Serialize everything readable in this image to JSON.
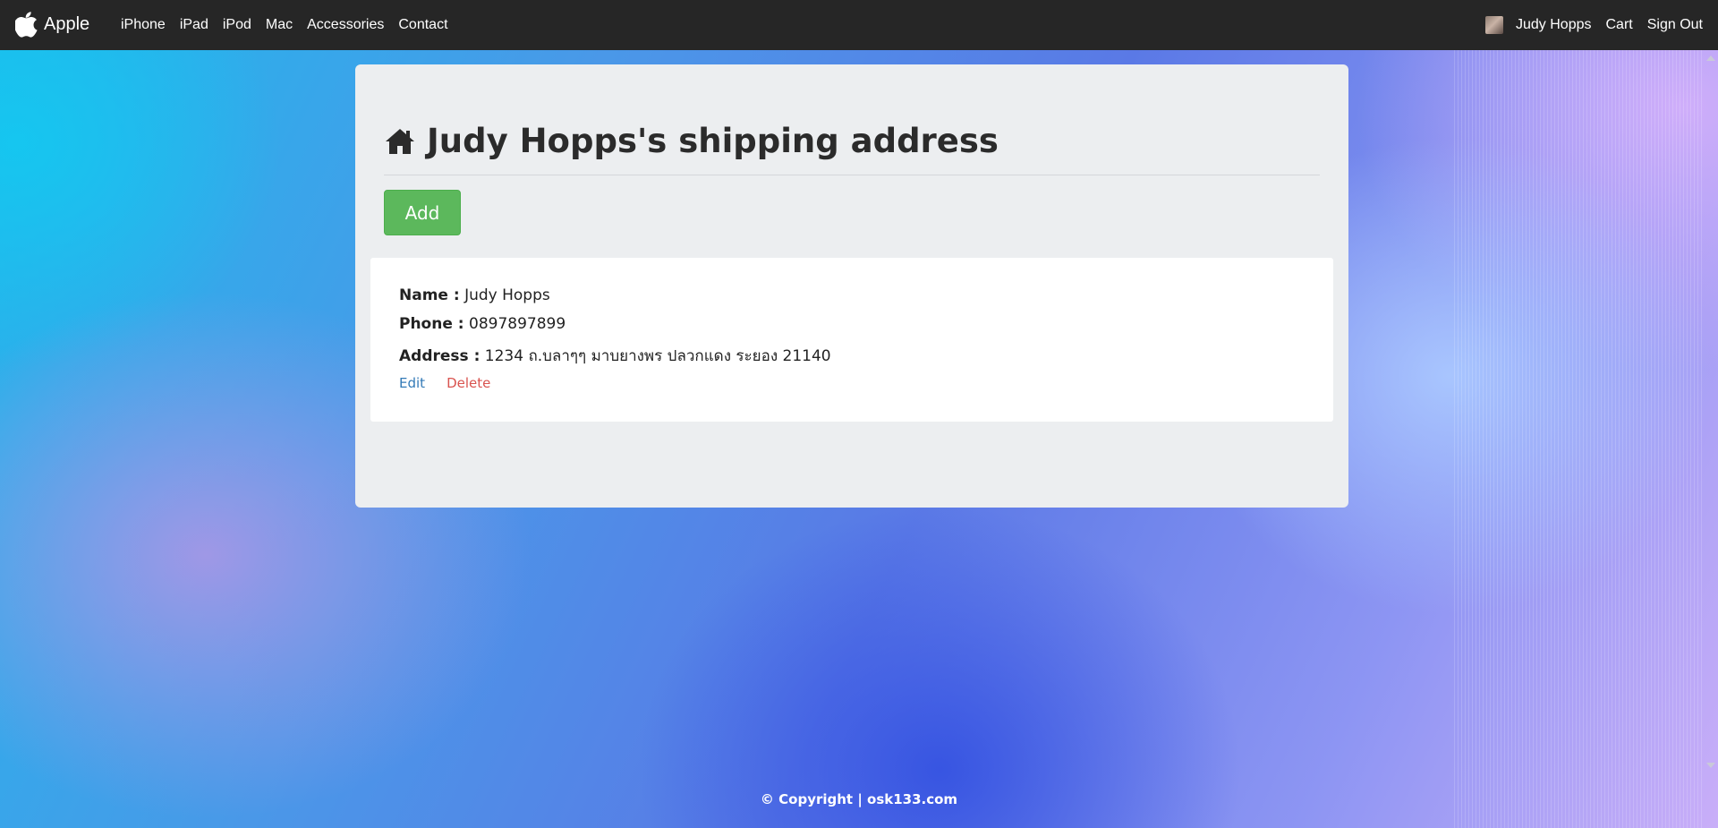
{
  "navbar": {
    "brand": "Apple",
    "links": [
      "iPhone",
      "iPad",
      "iPod",
      "Mac",
      "Accessories",
      "Contact"
    ],
    "user_name": "Judy Hopps",
    "cart": "Cart",
    "sign_out": "Sign Out"
  },
  "main": {
    "title": "Judy Hopps's shipping address",
    "add_label": "Add",
    "address": {
      "name_label": "Name :",
      "name": "Judy Hopps",
      "phone_label": "Phone :",
      "phone": "0897897899",
      "address_label": "Address :",
      "address": "1234 ถ.บลาๆๆ มาบยางพร ปลวกแดง ระยอง 21140",
      "edit_label": "Edit",
      "delete_label": "Delete"
    }
  },
  "footer": {
    "text": "© Copyright | osk133.com"
  },
  "colors": {
    "navbar": "#262626",
    "add_button": "#5cb85c",
    "edit_link": "#337ab7",
    "delete_link": "#d9534f"
  },
  "icons": {
    "brand": "apple-icon",
    "title": "home-icon"
  }
}
